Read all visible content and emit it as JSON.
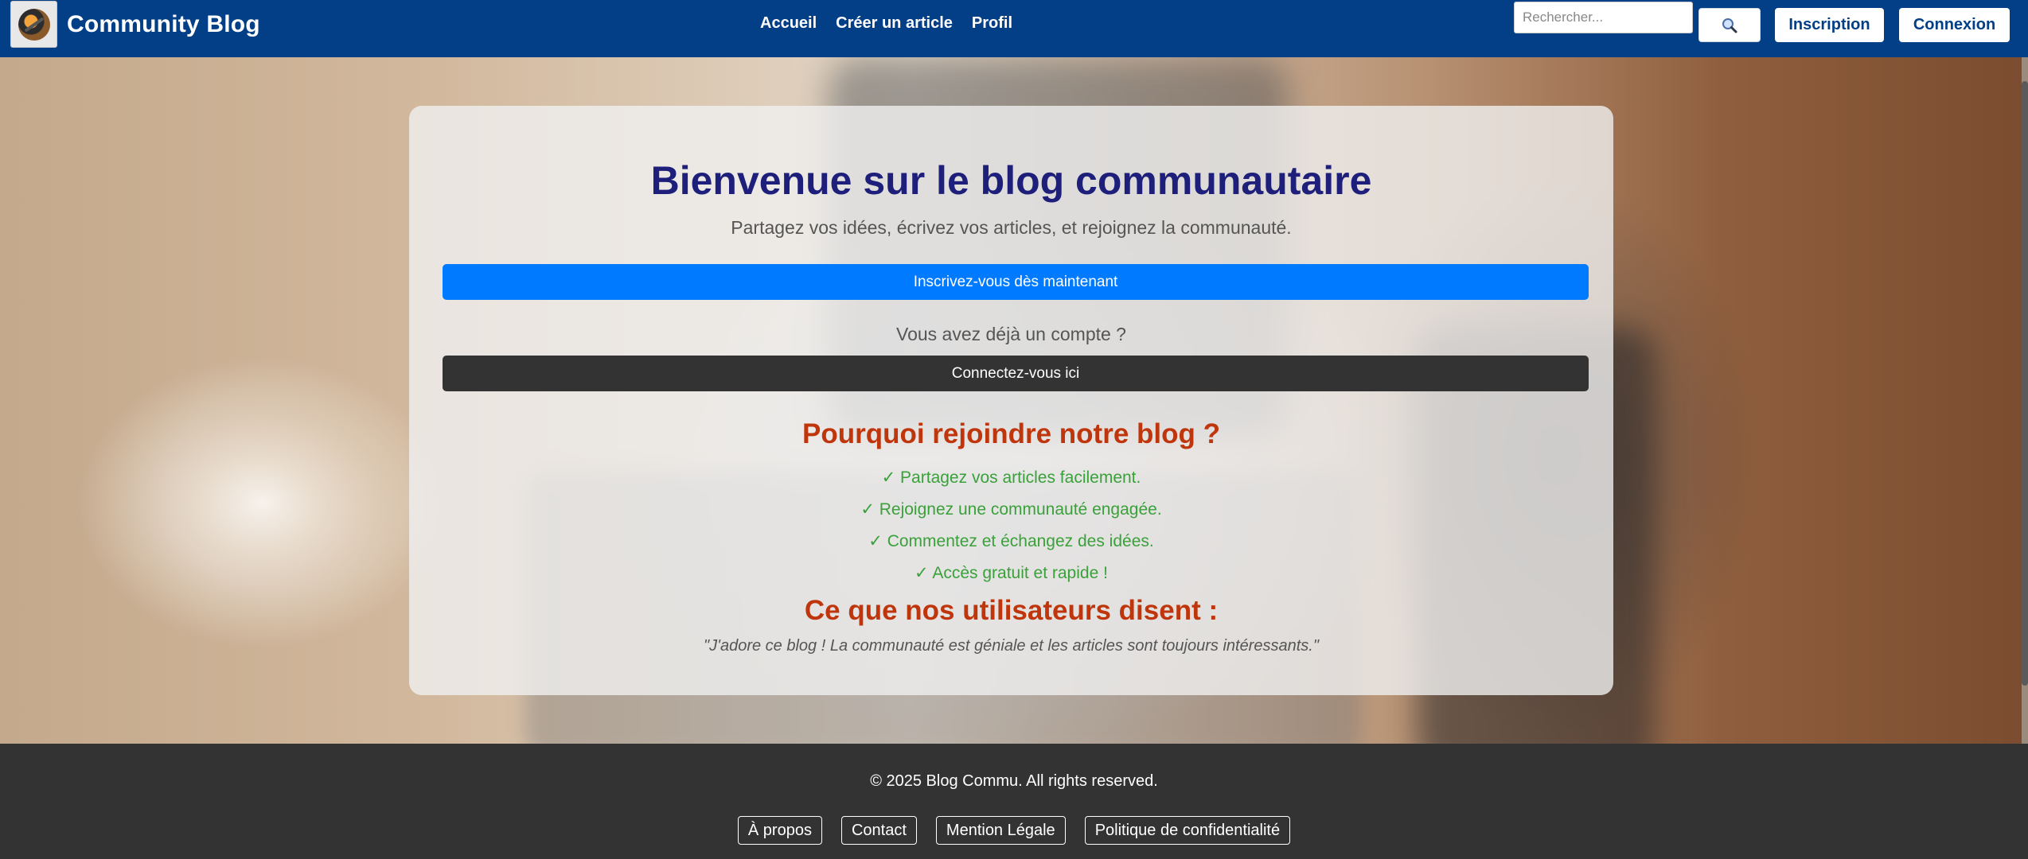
{
  "header": {
    "brand": "Community Blog",
    "nav": [
      "Accueil",
      "Créer un article",
      "Profil"
    ],
    "search_placeholder": "Rechercher...",
    "search_icon": "magnifier-icon",
    "inscription_label": "Inscription",
    "connexion_label": "Connexion"
  },
  "hero": {
    "title": "Bienvenue sur le blog communautaire",
    "subtitle": "Partagez vos idées, écrivez vos articles, et rejoignez la communauté.",
    "signup_button": "Inscrivez-vous dès maintenant",
    "already_account": "Vous avez déjà un compte ?",
    "login_button": "Connectez-vous ici",
    "why_title": "Pourquoi rejoindre notre blog ?",
    "benefits": [
      "✓ Partagez vos articles facilement.",
      "✓ Rejoignez une communauté engagée.",
      "✓ Commentez et échangez des idées.",
      "✓ Accès gratuit et rapide !"
    ],
    "testimonials_title": "Ce que nos utilisateurs disent :",
    "testimonial": "\"J'adore ce blog ! La communauté est géniale et les articles sont toujours intéressants.\""
  },
  "footer": {
    "copyright": "© 2025 Blog Commu. All rights reserved.",
    "links": [
      "À propos",
      "Contact",
      "Mention Légale",
      "Politique de confidentialité"
    ]
  },
  "colors": {
    "navbar": "#033f87",
    "primary_button": "#007bff",
    "dark_button": "#333333",
    "title": "#1d1f7a",
    "accent_red": "#c0360c",
    "benefit_green": "#3aa13a",
    "footer": "#333333"
  }
}
